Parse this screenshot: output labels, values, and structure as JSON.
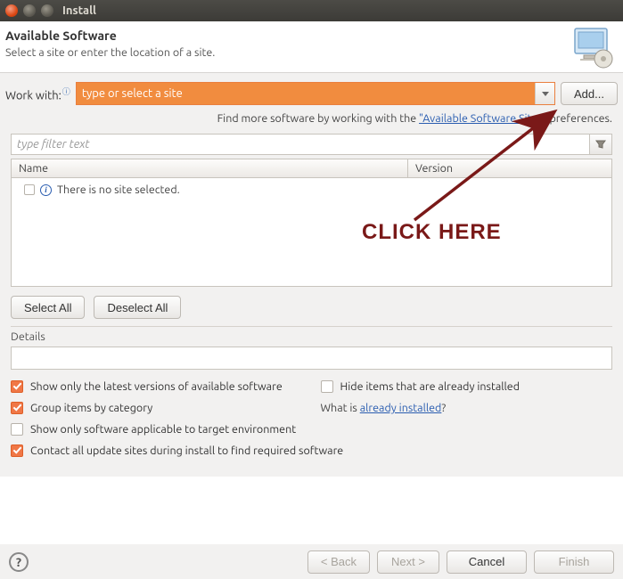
{
  "window": {
    "title": "Install"
  },
  "header": {
    "title": "Available Software",
    "subtitle": "Select a site or enter the location of a site."
  },
  "workwith": {
    "label": "Work with:",
    "value": "type or select a site",
    "add_label": "Add..."
  },
  "findmore": {
    "prefix": "Find more software by working with the ",
    "link": "\"Available Software Sites\"",
    "suffix": " preferences."
  },
  "filter": {
    "placeholder": "type filter text"
  },
  "tree": {
    "col_name": "Name",
    "col_version": "Version",
    "empty_msg": "There is no site selected."
  },
  "select_buttons": {
    "all": "Select All",
    "none": "Deselect All"
  },
  "details": {
    "label": "Details"
  },
  "checks": {
    "latest": "Show only the latest versions of available software",
    "hide_installed": "Hide items that are already installed",
    "group": "Group items by category",
    "whatis_prefix": "What is ",
    "whatis_link": "already installed",
    "whatis_suffix": "?",
    "applicable": "Show only software applicable to target environment",
    "contact": "Contact all update sites during install to find required software"
  },
  "footer": {
    "back": "< Back",
    "next": "Next >",
    "cancel": "Cancel",
    "finish": "Finish"
  },
  "annotation": {
    "text": "CLICK HERE"
  }
}
